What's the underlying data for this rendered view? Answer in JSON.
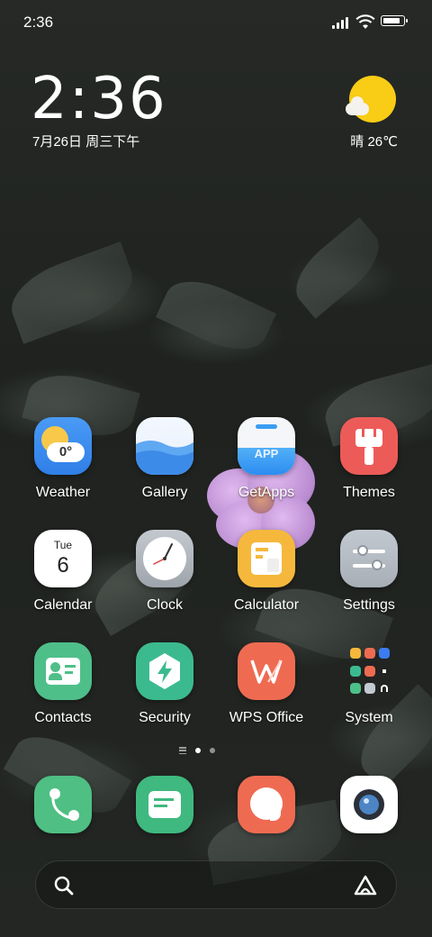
{
  "status_bar": {
    "time": "2:36",
    "battery_level": 0.85
  },
  "clock_widget": {
    "time": "2:36",
    "date": "7月26日 周三下午"
  },
  "weather_widget": {
    "condition_temp": "晴 26℃",
    "icon": "sunny-cloud-icon"
  },
  "apps": [
    {
      "label": "Weather",
      "icon": "weather-icon",
      "icon_text": "0°",
      "color": "#3d8bf0"
    },
    {
      "label": "Gallery",
      "icon": "gallery-icon",
      "color": "#6cb1f5"
    },
    {
      "label": "GetApps",
      "icon": "getapps-icon",
      "icon_text": "APP",
      "color": "#3a9df3"
    },
    {
      "label": "Themes",
      "icon": "themes-icon",
      "color": "#ea5c5a"
    },
    {
      "label": "Calendar",
      "icon": "calendar-icon",
      "icon_day": "Tue",
      "icon_date": "6",
      "color": "#ffffff"
    },
    {
      "label": "Clock",
      "icon": "clock-icon",
      "color": "#aeb3ba"
    },
    {
      "label": "Calculator",
      "icon": "calculator-icon",
      "color": "#f5b83d"
    },
    {
      "label": "Settings",
      "icon": "settings-icon",
      "color": "#b8bfc7"
    },
    {
      "label": "Contacts",
      "icon": "contacts-icon",
      "color": "#4fbf8a"
    },
    {
      "label": "Security",
      "icon": "security-icon",
      "color": "#3cba8f"
    },
    {
      "label": "WPS Office",
      "icon": "wps-office-icon",
      "color": "#ee6b52"
    },
    {
      "label": "System",
      "icon": "system-folder-icon"
    }
  ],
  "dock": [
    {
      "name": "phone",
      "icon": "phone-icon",
      "color": "#4fbf83"
    },
    {
      "name": "messages",
      "icon": "messages-icon",
      "color": "#3fb97f"
    },
    {
      "name": "browser",
      "icon": "browser-icon",
      "color": "#ee6b52"
    },
    {
      "name": "camera",
      "icon": "camera-icon",
      "color": "#ffffff"
    }
  ],
  "page_indicator": {
    "pages": 2,
    "current": 1
  },
  "search_bar": {
    "left_icon": "search-icon",
    "right_icon": "assistant-icon"
  }
}
